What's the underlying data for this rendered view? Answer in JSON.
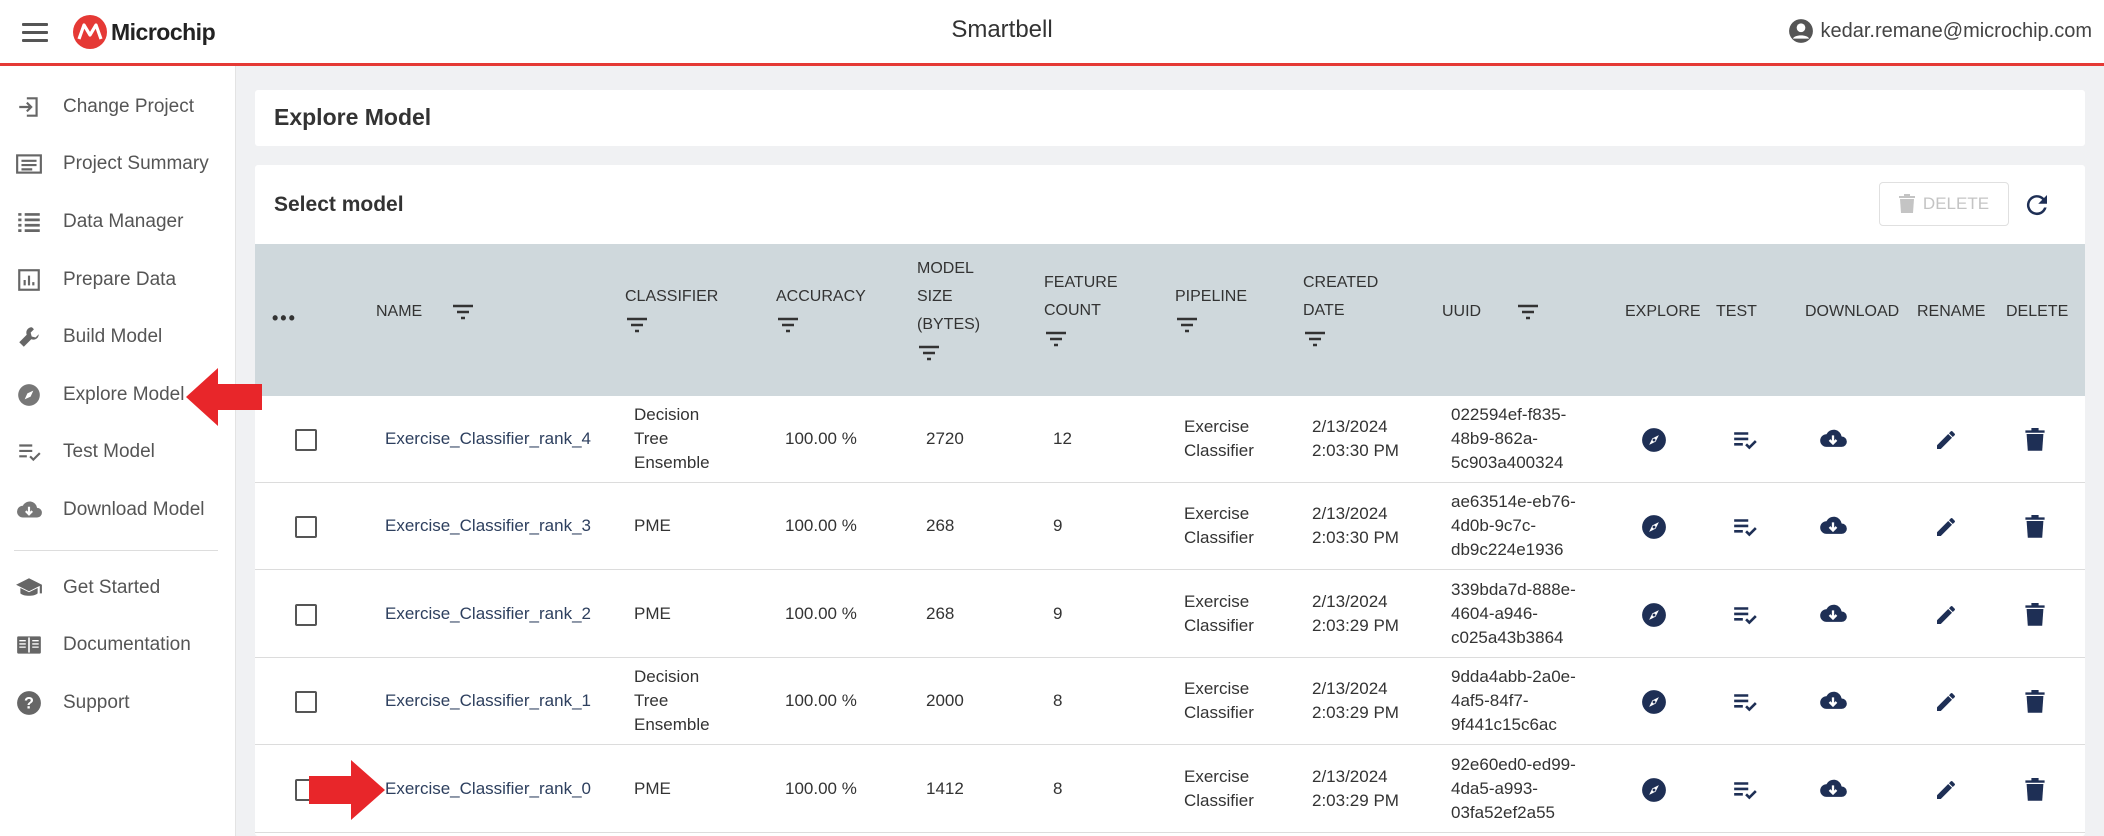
{
  "header": {
    "logo_text": "Microchip",
    "app_title": "Smartbell",
    "user_email": "kedar.remane@microchip.com"
  },
  "sidebar": {
    "items": [
      {
        "label": "Change Project",
        "icon": "login-icon"
      },
      {
        "label": "Project Summary",
        "icon": "summary-icon"
      },
      {
        "label": "Data Manager",
        "icon": "list-icon"
      },
      {
        "label": "Prepare Data",
        "icon": "chart-icon"
      },
      {
        "label": "Build Model",
        "icon": "wrench-icon"
      },
      {
        "label": "Explore Model",
        "icon": "compass-icon"
      },
      {
        "label": "Test Model",
        "icon": "playlist-check-icon"
      },
      {
        "label": "Download Model",
        "icon": "cloud-download-icon"
      }
    ],
    "secondary": [
      {
        "label": "Get Started",
        "icon": "school-icon"
      },
      {
        "label": "Documentation",
        "icon": "book-icon"
      },
      {
        "label": "Support",
        "icon": "help-icon"
      }
    ]
  },
  "page": {
    "title": "Explore Model",
    "section_title": "Select model",
    "delete_label": "DELETE"
  },
  "table": {
    "columns": {
      "name": "NAME",
      "classifier": "CLASSIFIER",
      "accuracy": "ACCURACY",
      "model_size": [
        "MODEL",
        "SIZE",
        "(BYTES)"
      ],
      "feature_count": [
        "FEATURE",
        "COUNT"
      ],
      "pipeline": "PIPELINE",
      "created_date": [
        "CREATED",
        "DATE"
      ],
      "uuid": "UUID",
      "explore": "EXPLORE",
      "test": "TEST",
      "download": "DOWNLOAD",
      "rename": "RENAME",
      "delete": "DELETE"
    },
    "rows": [
      {
        "name": "Exercise_Classifier_rank_4",
        "classifier": [
          "Decision",
          "Tree",
          "Ensemble"
        ],
        "accuracy": "100.00 %",
        "size": "2720",
        "features": "12",
        "pipeline": [
          "Exercise",
          "Classifier"
        ],
        "created": [
          "2/13/2024",
          "2:03:30 PM"
        ],
        "uuid": [
          "022594ef-f835-",
          "48b9-862a-",
          "5c903a400324"
        ]
      },
      {
        "name": "Exercise_Classifier_rank_3",
        "classifier": [
          "PME"
        ],
        "accuracy": "100.00 %",
        "size": "268",
        "features": "9",
        "pipeline": [
          "Exercise",
          "Classifier"
        ],
        "created": [
          "2/13/2024",
          "2:03:30 PM"
        ],
        "uuid": [
          "ae63514e-eb76-",
          "4d0b-9c7c-",
          "db9c224e1936"
        ]
      },
      {
        "name": "Exercise_Classifier_rank_2",
        "classifier": [
          "PME"
        ],
        "accuracy": "100.00 %",
        "size": "268",
        "features": "9",
        "pipeline": [
          "Exercise",
          "Classifier"
        ],
        "created": [
          "2/13/2024",
          "2:03:29 PM"
        ],
        "uuid": [
          "339bda7d-888e-",
          "4604-a946-",
          "c025a43b3864"
        ]
      },
      {
        "name": "Exercise_Classifier_rank_1",
        "classifier": [
          "Decision",
          "Tree",
          "Ensemble"
        ],
        "accuracy": "100.00 %",
        "size": "2000",
        "features": "8",
        "pipeline": [
          "Exercise",
          "Classifier"
        ],
        "created": [
          "2/13/2024",
          "2:03:29 PM"
        ],
        "uuid": [
          "9dda4abb-2a0e-",
          "4af5-84f7-",
          "9f441c15c6ac"
        ]
      },
      {
        "name": "Exercise_Classifier_rank_0",
        "classifier": [
          "PME"
        ],
        "accuracy": "100.00 %",
        "size": "1412",
        "features": "8",
        "pipeline": [
          "Exercise",
          "Classifier"
        ],
        "created": [
          "2/13/2024",
          "2:03:29 PM"
        ],
        "uuid": [
          "92e60ed0-ed99-",
          "4da5-a993-",
          "03fa52ef2a55"
        ]
      }
    ]
  },
  "colors": {
    "accent_red": "#e53935",
    "header_row": "#cfd8dc",
    "action_icon": "#1e2f55",
    "annotation_arrow": "#e8262a"
  }
}
